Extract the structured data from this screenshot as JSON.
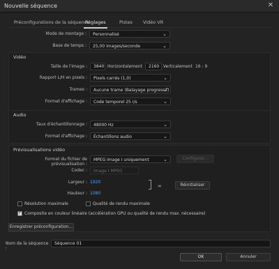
{
  "window": {
    "title": "Nouvelle séquence",
    "close_glyph": "✕"
  },
  "tabs": [
    {
      "label": "Préconfigurations de la séquence"
    },
    {
      "label": "Réglages"
    },
    {
      "label": "Pistes"
    },
    {
      "label": "Vidéo VR"
    }
  ],
  "general": {
    "montage_label": "Mode de montage :",
    "montage_value": "Personnalisé",
    "timebase_label": "Base de temps :",
    "timebase_value": "25,00  images/seconde"
  },
  "video": {
    "section_title": "Vidéo",
    "frame_size_label": "Taille de l'image :",
    "frame_w": "3840",
    "horizontal_label": "Horizontalement",
    "frame_h": "2160",
    "vertical_label": "Verticalement",
    "ratio": "16 : 9",
    "pixel_ratio_label": "Rapport L/H en pixels :",
    "pixel_ratio_value": "Pixels carrés (1,0)",
    "fields_label": "Trames :",
    "fields_value": "Aucune trame (Balayage progressif)",
    "display_label": "Format d'affichage :",
    "display_value": "Code temporel 25 i/s"
  },
  "audio": {
    "section_title": "Audio",
    "sample_rate_label": "Taux d'échantillonnage :",
    "sample_rate_value": "48000 Hz",
    "display_label": "Format d'affichage :",
    "display_value": "Échantillons audio"
  },
  "preview": {
    "section_title": "Prévisualisations vidéo",
    "file_format_label": "Format du fichier de prévisualisation :",
    "file_format_value": "MPEG image I uniquement",
    "configure_label": "Configurer...",
    "codec_label": "Codec :",
    "codec_value": "Image I MPEG",
    "width_label": "Largeur :",
    "width_value": "1920",
    "height_label": "Hauteur :",
    "height_value": "1080",
    "reset_label": "Réinitialiser",
    "max_res_label": "Résolution maximale",
    "max_quality_label": "Qualité de rendu maximale",
    "linear_label": "Composite en couleur linéaire (accélération GPU ou qualité de rendu max. nécessaire)",
    "max_res_checked": false,
    "max_quality_checked": false,
    "linear_checked": true
  },
  "save_preset_label": "Enregistrer préconfiguration...",
  "sequence_name_label": "Nom de la séquence :",
  "sequence_name_value": "Séquence 01",
  "ok_label": "OK",
  "cancel_label": "Annuler"
}
